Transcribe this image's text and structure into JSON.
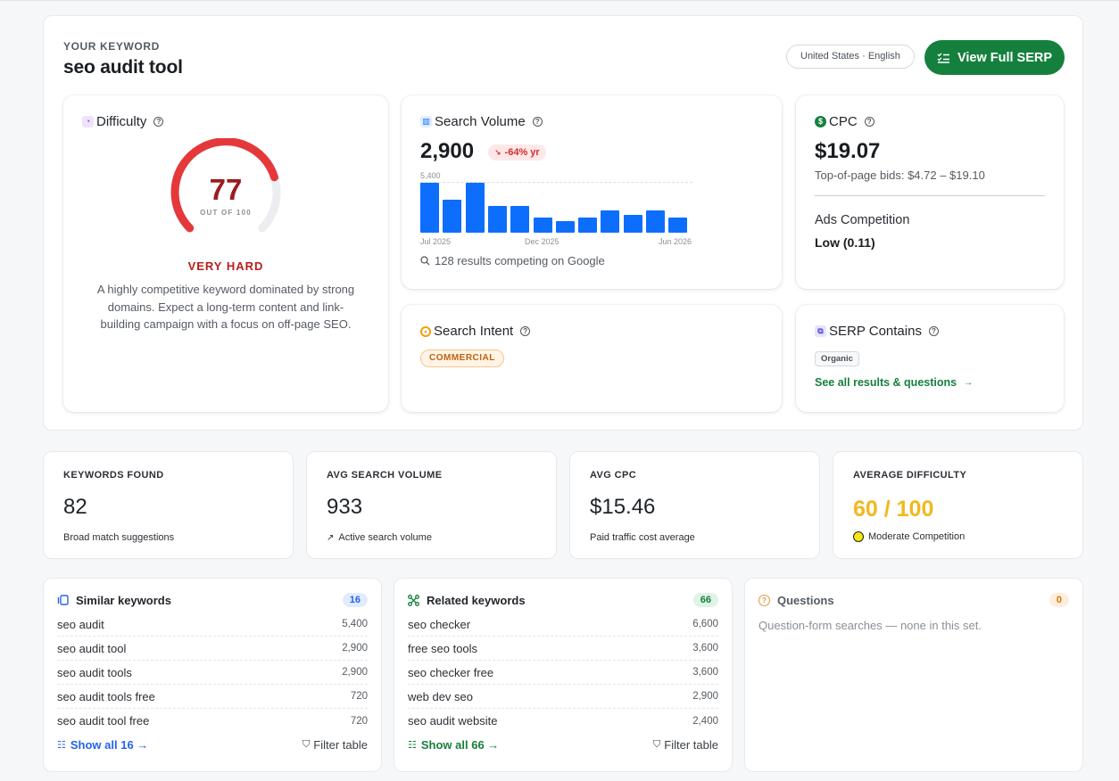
{
  "header": {
    "eyebrow": "YOUR KEYWORD",
    "keyword": "seo audit tool",
    "locale": "United States · English",
    "serp_button": "View Full SERP"
  },
  "difficulty": {
    "title": "Difficulty",
    "score": "77",
    "out_of": "OUT OF 100",
    "score_value": 77,
    "level": "VERY HARD",
    "description": "A highly competitive keyword dominated by strong domains. Expect a long-term content and link-building campaign with a focus on off-page SEO.",
    "color": "#e5383b"
  },
  "volume": {
    "title": "Search Volume",
    "value": "2,900",
    "trend": "-64% yr",
    "max_label": "5,400",
    "x_labels": [
      "Jul 2025",
      "Dec 2025",
      "Jun 2026"
    ],
    "results": "128 results competing on Google"
  },
  "chart_data": {
    "type": "bar",
    "values": [
      5400,
      3600,
      5400,
      2900,
      2900,
      1600,
      1300,
      1600,
      2400,
      1900,
      2400,
      1600
    ],
    "ylim": [
      0,
      5400
    ],
    "color": "#0d6efd"
  },
  "cpc": {
    "title": "CPC",
    "value": "$19.07",
    "bids": "Top-of-page bids: $4.72 – $19.10",
    "ads_label": "Ads Competition",
    "ads_value": "Low (0.11)"
  },
  "intent": {
    "title": "Search Intent",
    "badge": "COMMERCIAL"
  },
  "serp": {
    "title": "SERP Contains",
    "tag": "Organic",
    "link": "See all results & questions"
  },
  "stats": [
    {
      "caption": "KEYWORDS FOUND",
      "value": "82",
      "note": "Broad match suggestions"
    },
    {
      "caption": "AVG SEARCH VOLUME",
      "value": "933",
      "note": "Active search volume"
    },
    {
      "caption": "AVG CPC",
      "value": "$15.46",
      "note": "Paid traffic cost average"
    },
    {
      "caption": "AVERAGE DIFFICULTY",
      "value": "60 / 100",
      "note": "Moderate Competition"
    }
  ],
  "similar": {
    "title": "Similar keywords",
    "count": "16",
    "rows": [
      {
        "k": "seo audit",
        "v": "5,400"
      },
      {
        "k": "seo audit tool",
        "v": "2,900"
      },
      {
        "k": "seo audit tools",
        "v": "2,900"
      },
      {
        "k": "seo audit tools free",
        "v": "720"
      },
      {
        "k": "seo audit tool free",
        "v": "720"
      }
    ],
    "show_all": "Show all 16 →",
    "filter": "Filter table"
  },
  "related": {
    "title": "Related keywords",
    "count": "66",
    "rows": [
      {
        "k": "seo checker",
        "v": "6,600"
      },
      {
        "k": "free seo tools",
        "v": "3,600"
      },
      {
        "k": "seo checker free",
        "v": "3,600"
      },
      {
        "k": "web dev seo",
        "v": "2,900"
      },
      {
        "k": "seo audit website",
        "v": "2,400"
      }
    ],
    "show_all": "Show all 66 →",
    "filter": "Filter table"
  },
  "questions": {
    "title": "Questions",
    "count": "0",
    "empty": "Question-form searches — none in this set."
  }
}
